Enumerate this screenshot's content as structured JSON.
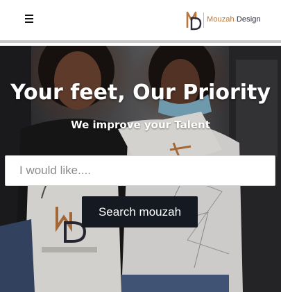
{
  "header": {
    "menu_icon": "hamburger-menu-icon",
    "logo": {
      "monogram": "MD",
      "brand_first": "Mouzah",
      "brand_second": "Design"
    }
  },
  "hero": {
    "title": "Your feet, Our Priority",
    "subtitle": "We improve your Talent",
    "search": {
      "placeholder": "I would like....",
      "value": ""
    },
    "search_button_label": "Search mouzah"
  },
  "colors": {
    "logo_accent": "#b8763f",
    "logo_dark": "#2b2b3a",
    "button_background": "#141922",
    "hero_text": "#ffffff"
  }
}
